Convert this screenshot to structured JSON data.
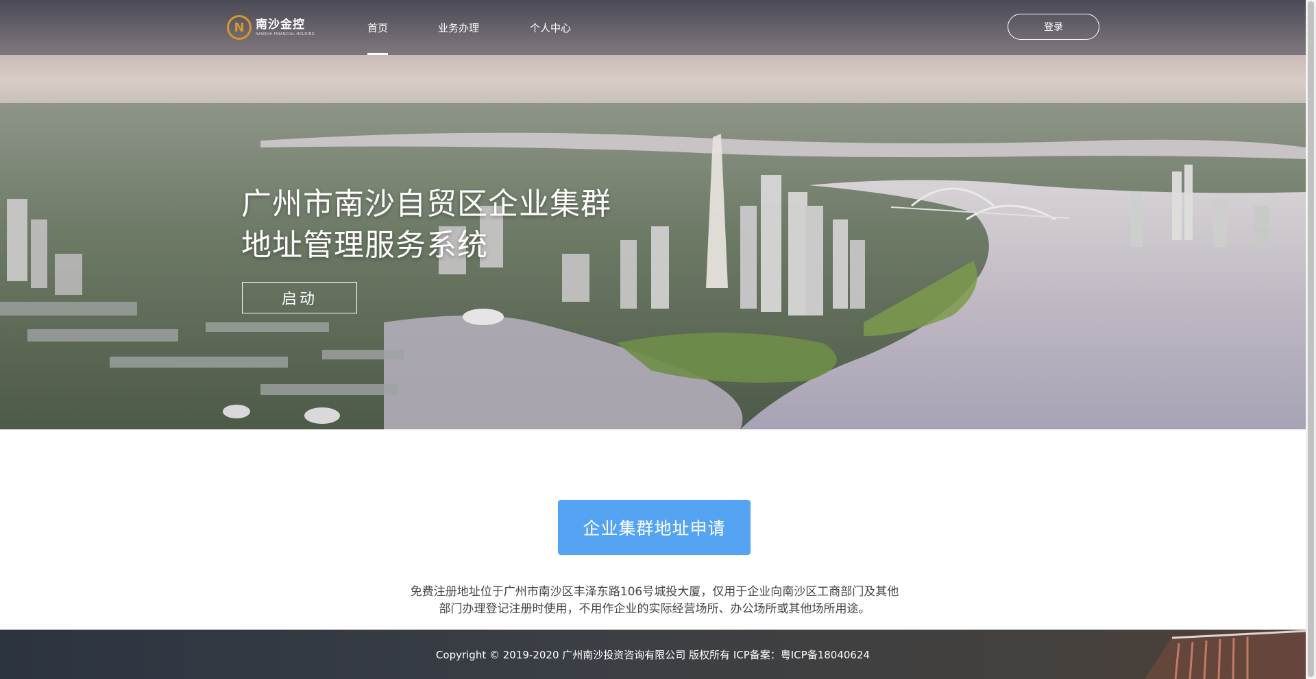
{
  "header": {
    "logo": {
      "mark_glyph": "N",
      "name": "南沙金控",
      "subtitle": "NANSHA FINANCIAL HOLDING",
      "color": "#d9962f"
    },
    "nav": [
      {
        "label": "首页",
        "active": true
      },
      {
        "label": "业务办理",
        "active": false
      },
      {
        "label": "个人中心",
        "active": false
      }
    ],
    "login_label": "登录"
  },
  "hero": {
    "title_line1": "广州市南沙自贸区企业集群",
    "title_line2": "地址管理服务系统",
    "start_label": "启动"
  },
  "main": {
    "apply_label": "企业集群地址申请",
    "apply_color": "#54a4f3",
    "notice_line1": "免费注册地址位于广州市南沙区丰泽东路106号城投大厦，仅用于企业向南沙区工商部门及其他",
    "notice_line2": "部门办理登记注册时使用，不用作企业的实际经营场所、办公场所或其他场所用途。"
  },
  "footer": {
    "copyright": "Copyright © 2019-2020 广州南沙投资咨询有限公司 版权所有 ICP备案：粤ICP备18040624"
  }
}
